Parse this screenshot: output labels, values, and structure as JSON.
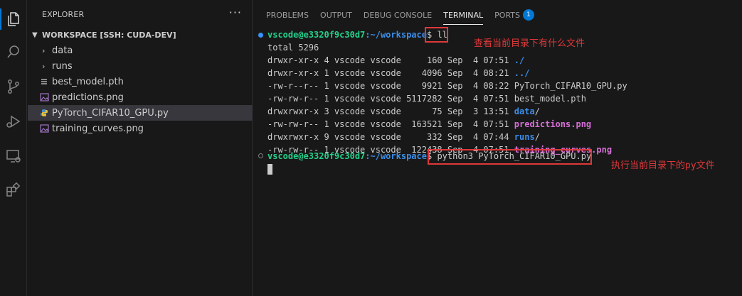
{
  "sidebar": {
    "title": "EXPLORER",
    "more": "···",
    "workspace_title": "WORKSPACE [SSH: CUDA-DEV]",
    "items": [
      {
        "label": "data",
        "kind": "folder"
      },
      {
        "label": "runs",
        "kind": "folder"
      },
      {
        "label": "best_model.pth",
        "kind": "file"
      },
      {
        "label": "predictions.png",
        "kind": "image"
      },
      {
        "label": "PyTorch_CIFAR10_GPU.py",
        "kind": "python"
      },
      {
        "label": "training_curves.png",
        "kind": "image"
      }
    ]
  },
  "panel": {
    "tabs": [
      {
        "label": "PROBLEMS"
      },
      {
        "label": "OUTPUT"
      },
      {
        "label": "DEBUG CONSOLE"
      },
      {
        "label": "TERMINAL"
      },
      {
        "label": "PORTS",
        "badge": "1"
      }
    ]
  },
  "terminal": {
    "prompt_user": "vscode@e3320f9c30d7",
    "prompt_path": ":~/workspace",
    "prompt_sym": "$",
    "cmd1": " ll",
    "total": "total 5296",
    "listing": [
      {
        "meta": "drwxr-xr-x 4 vscode vscode     160 Sep  4 07:51 ",
        "name": "./",
        "type": "dir",
        "suffix": ""
      },
      {
        "meta": "drwxr-xr-x 1 vscode vscode    4096 Sep  4 08:21 ",
        "name": "../",
        "type": "dir",
        "suffix": ""
      },
      {
        "meta": "-rw-r--r-- 1 vscode vscode    9921 Sep  4 08:22 ",
        "name": "PyTorch_CIFAR10_GPU.py",
        "type": "file",
        "suffix": ""
      },
      {
        "meta": "-rw-rw-r-- 1 vscode vscode 5117282 Sep  4 07:51 ",
        "name": "best_model.pth",
        "type": "file",
        "suffix": ""
      },
      {
        "meta": "drwxrwxr-x 3 vscode vscode      75 Sep  3 13:51 ",
        "name": "data",
        "type": "dir",
        "suffix": "/"
      },
      {
        "meta": "-rw-rw-r-- 1 vscode vscode  163521 Sep  4 07:51 ",
        "name": "predictions.png",
        "type": "png",
        "suffix": ""
      },
      {
        "meta": "drwxrwxr-x 9 vscode vscode     332 Sep  4 07:44 ",
        "name": "runs",
        "type": "dir",
        "suffix": "/"
      },
      {
        "meta": "-rw-rw-r-- 1 vscode vscode  122438 Sep  4 07:51 ",
        "name": "training_curves.png",
        "type": "png",
        "suffix": ""
      }
    ],
    "cmd2": " python3 PyTorch_CIFAR10_GPU.py"
  },
  "annotations": {
    "note1": "查看当前目录下有什么文件",
    "note2": "执行当前目录下的py文件"
  },
  "colors": {
    "accent": "#0078d4",
    "annotation_red": "#e0383a",
    "prompt_green": "#23d18b",
    "path_blue": "#3b8eea",
    "png_magenta": "#d670d6"
  }
}
